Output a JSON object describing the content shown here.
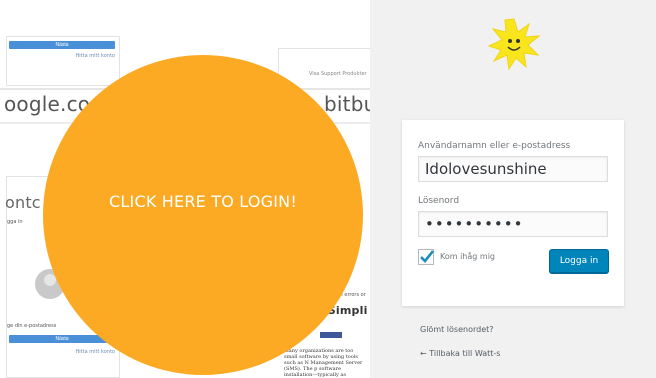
{
  "left": {
    "top_button_label": "Nästa",
    "help_link_top": "Hitta mitt konto",
    "nav_small": "Visa   Support   Produkter",
    "site_google": "oogle.com",
    "site_bitbucket": "bitbuc",
    "edge_text_1": "ontc",
    "edge_text_2": "gga in",
    "email_prompt": "ge din e-postadress",
    "bottom_button_label": "Nästa",
    "help_link_bottom": "Hitta mitt konto",
    "article_heading": "o Simpli",
    "article_text": "many organizations are too small software by using tools such as N Management Server (SMS). The p software installation—typically as",
    "snippet_right": "cour",
    "snippet_right_2": "nual errors or c",
    "circle_label": "CLICK HERE TO LOGIN!"
  },
  "login": {
    "username_label": "Användarnamn eller e-postadress",
    "username_value": "Idolovesunshine",
    "password_label": "Lösenord",
    "password_value": "••••••••••",
    "remember_label": "Kom ihåg mig",
    "remember_checked": true,
    "submit_label": "Logga in",
    "lost_password": "Glömt lösenordet?",
    "back_link": "← Tillbaka till Watt-s",
    "accent_color": "#0085ba",
    "background_color": "#f1f1f1"
  },
  "icons": {
    "logo": "sun-logo-icon",
    "checkmark": "checkmark-icon"
  }
}
